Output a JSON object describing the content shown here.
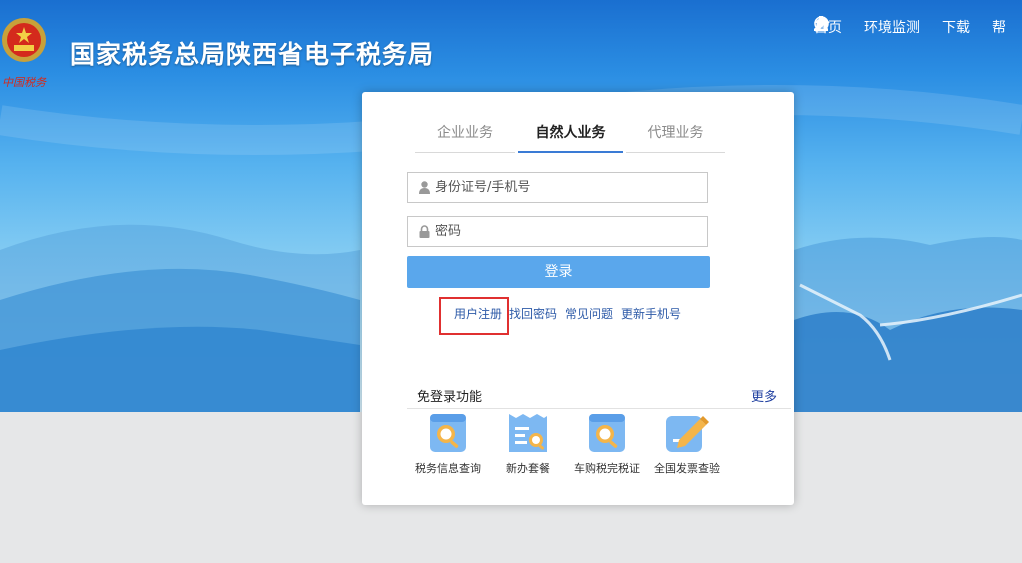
{
  "header": {
    "site_title": "国家税务总局陕西省电子税务局",
    "emblem_icon": "national-emblem-icon",
    "emblem_script": "中国税务"
  },
  "topnav": [
    {
      "label": "首页",
      "icon": "home-icon"
    },
    {
      "label": "环境监测",
      "icon": "wrench-icon"
    },
    {
      "label": "下载",
      "icon": "download-icon"
    },
    {
      "label": "帮",
      "icon": "info-icon"
    }
  ],
  "login": {
    "tabs": [
      {
        "label": "企业业务",
        "active": false
      },
      {
        "label": "自然人业务",
        "active": true
      },
      {
        "label": "代理业务",
        "active": false
      }
    ],
    "username_placeholder": "身份证号/手机号",
    "password_placeholder": "密码",
    "submit_label": "登录",
    "links": [
      "用户注册",
      "找回密码",
      "常见问题",
      "更新手机号"
    ]
  },
  "free_login": {
    "title": "免登录功能",
    "more_label": "更多",
    "items": [
      {
        "label": "税务信息查询",
        "icon": "search-doc-icon"
      },
      {
        "label": "新办套餐",
        "icon": "new-package-icon"
      },
      {
        "label": "车购税完税证",
        "icon": "vehicle-tax-icon"
      },
      {
        "label": "全国发票查验",
        "icon": "invoice-check-icon"
      }
    ]
  },
  "colors": {
    "accent": "#5aa7ec",
    "link": "#2e5ba8",
    "highlight": "#e03030"
  }
}
